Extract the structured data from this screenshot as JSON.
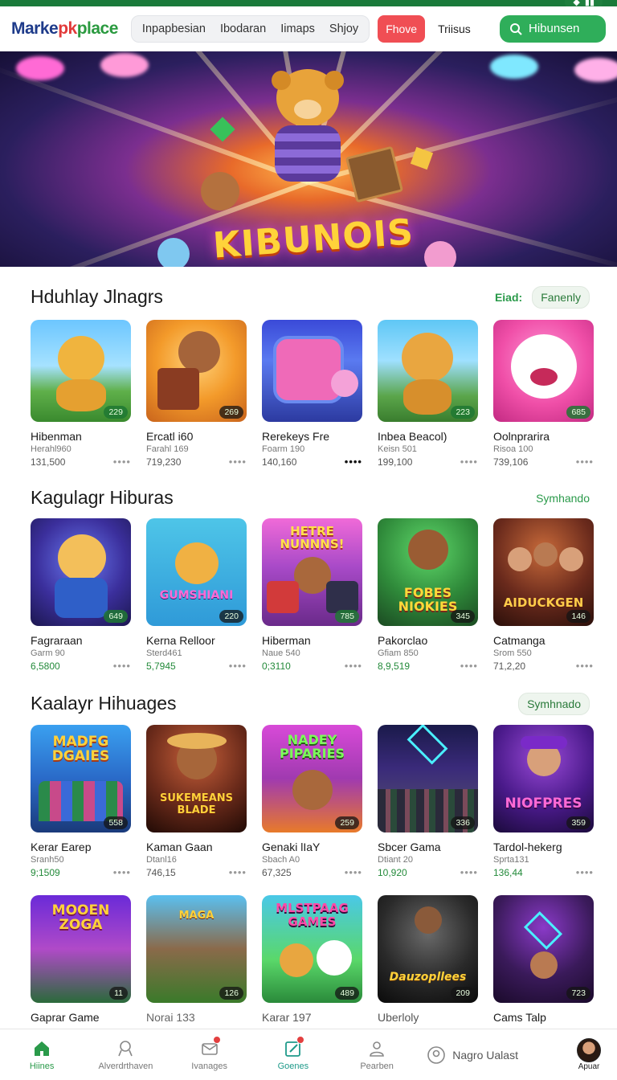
{
  "header": {
    "logo": {
      "a": "Marke",
      "b": "p",
      "c": "k",
      "d": "place"
    },
    "nav_items": [
      "Inpapbesian",
      "Ibodaran",
      "Iimaps",
      "Shjoy"
    ],
    "nav_button": "Fhove",
    "nav_link": "Triisus",
    "search_label": "Hibunsen"
  },
  "hero": {
    "title": "KIBUNOIS",
    "slide_count": 3
  },
  "sections": [
    {
      "title": "Hduhlay Jlnagrs",
      "right_link": "Eiad:",
      "right_pill": "Fanenly",
      "cards": [
        {
          "title": "Hibenman",
          "sub": "Herahl960",
          "val": "131,500",
          "badge": "229"
        },
        {
          "title": "Ercatl i60",
          "sub": "Farahl 169",
          "val": "719,230",
          "badge": "269"
        },
        {
          "title": "Rerekeys Fre",
          "sub": "Foarm 190",
          "val": "140,160",
          "badge": ""
        },
        {
          "title": "Inbea Beacol)",
          "sub": "Keisn 501",
          "val": "199,100",
          "badge": "223"
        },
        {
          "title": "Oolnprarira",
          "sub": "Risoa 100",
          "val": "739,106",
          "badge": "685"
        }
      ]
    },
    {
      "title": "Kagulagr Hiburas",
      "right_link": "Symhando",
      "cards": [
        {
          "title": "Fagraraan",
          "sub": "Garm 90",
          "val": "6,5800",
          "badge": "649"
        },
        {
          "title": "Kerna Relloor",
          "sub": "Sterd461",
          "val": "5,7945",
          "badge": "220"
        },
        {
          "title": "Hiberman",
          "sub": "Naue 540",
          "val": "0;3110",
          "badge": "785"
        },
        {
          "title": "Pakorclao",
          "sub": "Gfiam 850",
          "val": "8,9,519",
          "badge": "345"
        },
        {
          "title": "Catmanga",
          "sub": "Srom 550",
          "val": "71,2,20",
          "badge": "146"
        }
      ]
    },
    {
      "title": "Kaalayr Hihuages",
      "right_pill": "Symhnado",
      "cards": [
        {
          "title": "Kerar Earep",
          "sub": "Sranh50",
          "val": "9;1509",
          "badge": "558",
          "art": "MADFG DGAIES"
        },
        {
          "title": "Kaman Gaan",
          "sub": "Dtanl16",
          "val": "746,15",
          "badge": "",
          "art": "SUKEMEANS BLADE"
        },
        {
          "title": "Genaki lIaY",
          "sub": "Sbach A0",
          "val": "67,325",
          "badge": "259",
          "art": "NADEY PIPARIES"
        },
        {
          "title": "Sbcer Gama",
          "sub": "Dtiant 20",
          "val": "10,920",
          "badge": "336",
          "art": ""
        },
        {
          "title": "Tardol-hekerg",
          "sub": "Sprta131",
          "val": "136,44",
          "badge": "359",
          "art": "NIOFPRES"
        }
      ]
    },
    {
      "cards": [
        {
          "title": "Gaprar Game",
          "badge": "11",
          "art": "MOOEN ZOGA"
        },
        {
          "title": "Norai 133",
          "badge": "126",
          "art": "MAGA"
        },
        {
          "title": "Karar 197",
          "badge": "489",
          "art": "MLSTPAAG GAMES"
        },
        {
          "title": "Uberloly",
          "badge": "209",
          "art": "Dauzopllees"
        },
        {
          "title": "Cams Talp",
          "badge": "723",
          "art": ""
        }
      ]
    }
  ],
  "row2_art": [
    "",
    "GUMSHIANI",
    "HETRE NUNNNS!",
    "FOBES NIOKIES",
    "AIDUCKGEN"
  ],
  "bottom_nav": {
    "items": [
      "Hiines",
      "Alverdrthaven",
      "Ivanages",
      "Goenes",
      "Pearben"
    ],
    "user_label": "Nagro Ualast",
    "avatar_label": "Apuar"
  },
  "colors": {
    "brand_green": "#2fae5a",
    "accent_red": "#f04e54",
    "text_green": "#2a9a4a"
  }
}
